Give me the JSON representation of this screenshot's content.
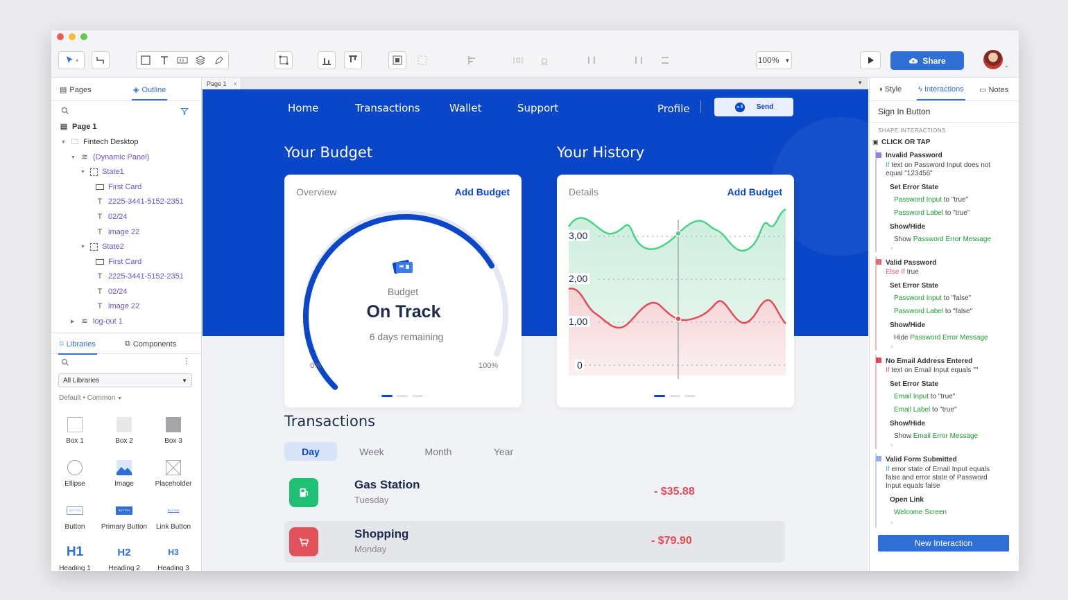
{
  "toolbar": {
    "zoom": "100%",
    "share_label": "Share"
  },
  "left_panel": {
    "tabs": [
      {
        "label": "Pages"
      },
      {
        "label": "Outline"
      }
    ],
    "tree": [
      {
        "label": "Page 1"
      },
      {
        "label": "Fintech Desktop"
      },
      {
        "label": "(Dynamic Panel)"
      },
      {
        "label": "State1"
      },
      {
        "label": "First Card"
      },
      {
        "label": "2225-3441-5152-2351"
      },
      {
        "label": "02/24"
      },
      {
        "label": "image 22"
      },
      {
        "label": "State2"
      },
      {
        "label": "First Card"
      },
      {
        "label": "2225-3441-5152-2351"
      },
      {
        "label": "02/24"
      },
      {
        "label": "image 22"
      },
      {
        "label": "log-out 1"
      }
    ],
    "lib_tabs": [
      {
        "label": "Libraries"
      },
      {
        "label": "Components"
      }
    ],
    "library_select": "All Libraries",
    "library_filter": "Default • Common",
    "widgets": [
      {
        "label": "Box 1"
      },
      {
        "label": "Box 2"
      },
      {
        "label": "Box 3"
      },
      {
        "label": "Ellipse"
      },
      {
        "label": "Image"
      },
      {
        "label": "Placeholder"
      },
      {
        "label": "Button"
      },
      {
        "label": "Primary Button"
      },
      {
        "label": "Link Button"
      },
      {
        "label": "Heading 1"
      },
      {
        "label": "Heading 2"
      },
      {
        "label": "Heading 3"
      }
    ],
    "button_mini": "BUTTON",
    "heading_icons": [
      "H1",
      "H2",
      "H3"
    ]
  },
  "canvas": {
    "page_tab": "Page 1",
    "nav": {
      "home": "Home",
      "transactions": "Transactions",
      "wallet": "Wallet",
      "support": "Support",
      "profile": "Profile",
      "send": "Send"
    },
    "budget": {
      "title": "Your Budget",
      "overview": "Overview",
      "add": "Add Budget",
      "label": "Budget",
      "status": "On Track",
      "remaining": "6 days remaining",
      "min": "0%",
      "max": "100%",
      "progress": 0.72
    },
    "history": {
      "title": "Your History",
      "details": "Details",
      "add": "Add Budget",
      "yticks": [
        "3,00",
        "2,00",
        "1,00",
        "0"
      ]
    },
    "transactions": {
      "title": "Transactions",
      "periods": [
        {
          "label": "Day"
        },
        {
          "label": "Week"
        },
        {
          "label": "Month"
        },
        {
          "label": "Year"
        }
      ],
      "rows": [
        {
          "name": "Gas Station",
          "day": "Tuesday",
          "amount": "- $35.88"
        },
        {
          "name": "Shopping",
          "day": "Monday",
          "amount": "- $79.90"
        }
      ]
    }
  },
  "right_panel": {
    "tabs": [
      {
        "label": "Style"
      },
      {
        "label": "Interactions"
      },
      {
        "label": "Notes"
      }
    ],
    "selected": "Sign In Button",
    "section": "SHAPE INTERACTIONS",
    "event": "CLICK OR TAP",
    "cases": [
      {
        "title": "Invalid Password",
        "cond_kw": "If",
        "cond": "text on Password Input does not",
        "cond2": "equal \"123456\"",
        "a1": "Set Error State",
        "a1l1t": "Password Input",
        "a1l1v": " to \"true\"",
        "a1l2t": "Password Label",
        "a1l2v": " to \"true\"",
        "a2": "Show/Hide",
        "a2verb": "Show ",
        "a2t": "Password Error Message"
      },
      {
        "title": "Valid Password",
        "cond_kw": "Else If",
        "cond": "true",
        "a1": "Set Error State",
        "a1l1t": "Password Input",
        "a1l1v": " to \"false\"",
        "a1l2t": "Password Label",
        "a1l2v": " to \"false\"",
        "a2": "Show/Hide",
        "a2verb": "Hide ",
        "a2t": "Password Error Message"
      },
      {
        "title": "No Email Address Entered",
        "cond_kw": "If",
        "cond": "text on Email Input equals \"\"",
        "a1": "Set Error State",
        "a1l1t": "Email Input",
        "a1l1v": " to \"true\"",
        "a1l2t": "Email Label",
        "a1l2v": " to \"true\"",
        "a2": "Show/Hide",
        "a2verb": "Show ",
        "a2t": "Email Error Message"
      },
      {
        "title": "Valid Form Submitted",
        "cond_kw": "If",
        "cond": "error state of Email Input equals",
        "cond2": "false and error state of Password",
        "cond3": "Input equals false",
        "a1": "Open Link",
        "a1l1t": "Welcome Screen"
      }
    ],
    "plus": "+",
    "new_interaction": "New Interaction"
  }
}
